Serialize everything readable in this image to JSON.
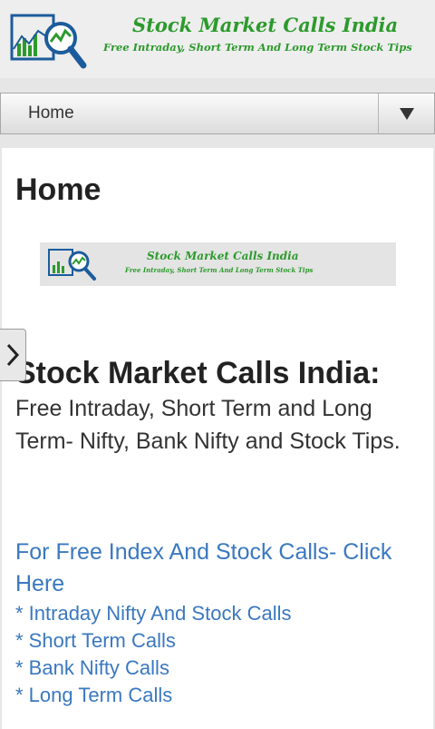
{
  "header": {
    "site_title": "Stock Market Calls India",
    "site_tagline": "Free Intraday, Short Term And Long Term Stock Tips",
    "brand_color": "#2c9a2c"
  },
  "nav": {
    "home_label": "Home",
    "toggle_icon": "triangle-down-icon"
  },
  "main": {
    "page_title": "Home",
    "banner": {
      "title": "Stock Market Calls India",
      "tagline": "Free Intraday, Short Term And Long Term Stock Tips"
    },
    "intro_bold": "Stock Market Calls India:",
    "intro_text": " Free Intraday, Short Term and Long Term- Nifty, Bank Nifty and Stock Tips.",
    "lead_link": "For Free Index And Stock Calls- Click Here",
    "links": [
      "* Intraday Nifty And Stock Calls",
      "* Short Term Calls",
      "* Bank Nifty Calls",
      "* Long Term Calls"
    ],
    "link_color": "#3a78c0"
  },
  "side_tab_icon": "chevron-right-icon"
}
